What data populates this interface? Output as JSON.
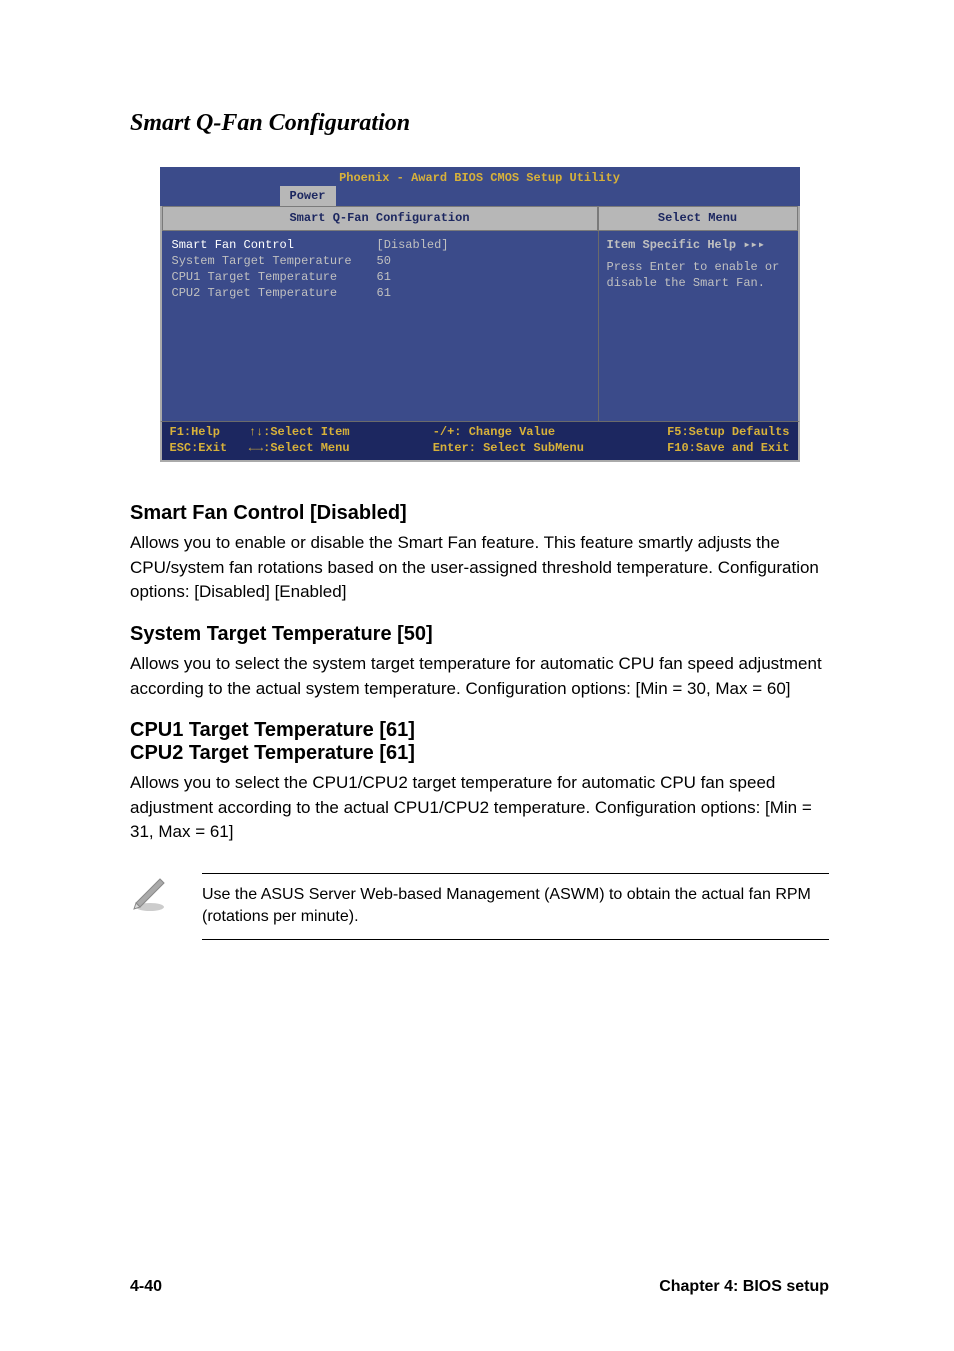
{
  "page_title": "Smart Q-Fan Configuration",
  "bios": {
    "top_title": "Phoenix - Award BIOS CMOS Setup Utility",
    "tab": "Power",
    "left_header": "Smart Q-Fan Configuration",
    "right_header": "Select Menu",
    "settings": [
      {
        "label": "Smart Fan Control",
        "value": "[Disabled]",
        "highlight": true
      },
      {
        "label": "System Target Temperature",
        "value": " 50",
        "highlight": false
      },
      {
        "label": "CPU1 Target Temperature",
        "value": " 61",
        "highlight": false
      },
      {
        "label": "CPU2 Target Temperature",
        "value": " 61",
        "highlight": false
      }
    ],
    "help_title": "Item Specific Help ▸▸▸",
    "help_text": "Press Enter to enable or disable the Smart Fan.",
    "footer": {
      "c1": "F1:Help    ↑↓:Select Item\nESC:Exit   ←→:Select Menu",
      "c2": "-/+: Change Value\nEnter: Select SubMenu",
      "c3": "F5:Setup Defaults\nF10:Save and Exit"
    }
  },
  "sections": [
    {
      "heading": "Smart Fan Control [Disabled]",
      "body": "Allows you to enable or disable the Smart Fan feature. This feature smartly adjusts the CPU/system fan rotations  based on the user-assigned threshold temperature. Configuration options: [Disabled] [Enabled]"
    },
    {
      "heading": "System Target Temperature [50]",
      "body": "Allows you to select the system target temperature for automatic CPU fan speed adjustment according to the actual system temperature. Configuration options: [Min = 30, Max = 60]"
    },
    {
      "heading": "CPU1 Target Temperature [61]\nCPU2 Target Temperature [61]",
      "body": "Allows you to select the CPU1/CPU2 target temperature for automatic CPU fan speed adjustment according to the actual CPU1/CPU2 temperature. Configuration options: [Min = 31, Max = 61]"
    }
  ],
  "note": "Use the ASUS Server Web-based Management (ASWM) to obtain the actual fan RPM (rotations per minute).",
  "footer_left": "4-40",
  "footer_right": "Chapter 4: BIOS setup"
}
